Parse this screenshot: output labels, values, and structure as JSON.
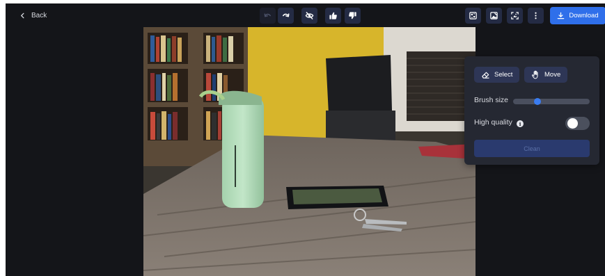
{
  "header": {
    "back_label": "Back",
    "download_label": "Download"
  },
  "toolbar": {
    "history": [
      {
        "icon": "undo-icon",
        "enabled": false
      },
      {
        "icon": "redo-icon",
        "enabled": true
      }
    ],
    "center_actions": [
      {
        "icon": "eye-off-icon"
      },
      {
        "icon": "thumbs-up-icon"
      },
      {
        "icon": "thumbs-down-icon"
      }
    ],
    "right_actions": [
      {
        "icon": "compare-icon"
      },
      {
        "icon": "image-edit-icon"
      },
      {
        "icon": "focus-frame-icon"
      },
      {
        "icon": "more-vertical-icon"
      }
    ]
  },
  "panel": {
    "select_label": "Select",
    "move_label": "Move",
    "brush_size_label": "Brush size",
    "brush_size_fraction": 0.3,
    "high_quality_label": "High quality",
    "high_quality_on": false,
    "clean_label": "Clean"
  },
  "colors": {
    "background": "#141519",
    "accent": "#2f6fea",
    "panel": "#252832",
    "button": "#242b44"
  }
}
